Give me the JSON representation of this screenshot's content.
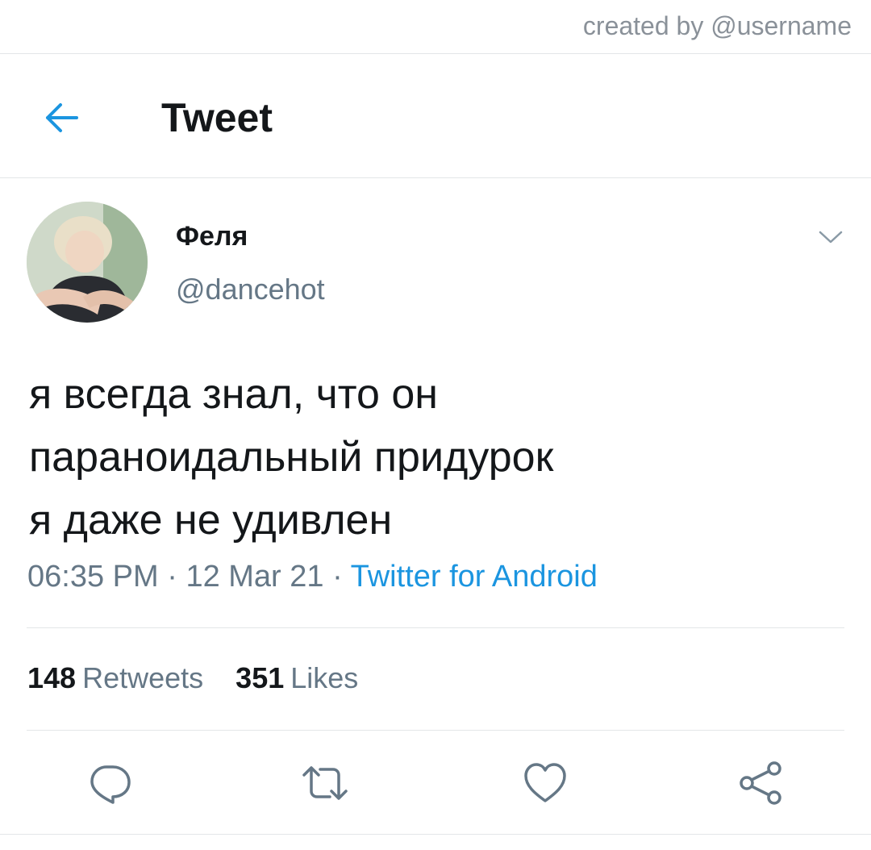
{
  "watermark": "created by @username",
  "header": {
    "title": "Tweet",
    "back_icon": "arrow-left-icon"
  },
  "tweet": {
    "display_name": "Феля",
    "handle": "@dancehot",
    "text_lines": [
      "я всегда знал, что он",
      "параноидальный придурок",
      "я даже не удивлен"
    ],
    "time": "06:35 PM",
    "date": "12 Mar 21",
    "separator": "·",
    "source": "Twitter for Android",
    "retweets_count": "148",
    "retweets_label": "Retweets",
    "likes_count": "351",
    "likes_label": "Likes"
  },
  "actions": {
    "icons": [
      "reply-icon",
      "retweet-icon",
      "like-icon",
      "share-icon"
    ]
  },
  "colors": {
    "accent": "#1b95e0",
    "secondary_text": "#657786",
    "primary_text": "#14171a",
    "divider": "#e3e6e8",
    "icon": "#657786"
  }
}
